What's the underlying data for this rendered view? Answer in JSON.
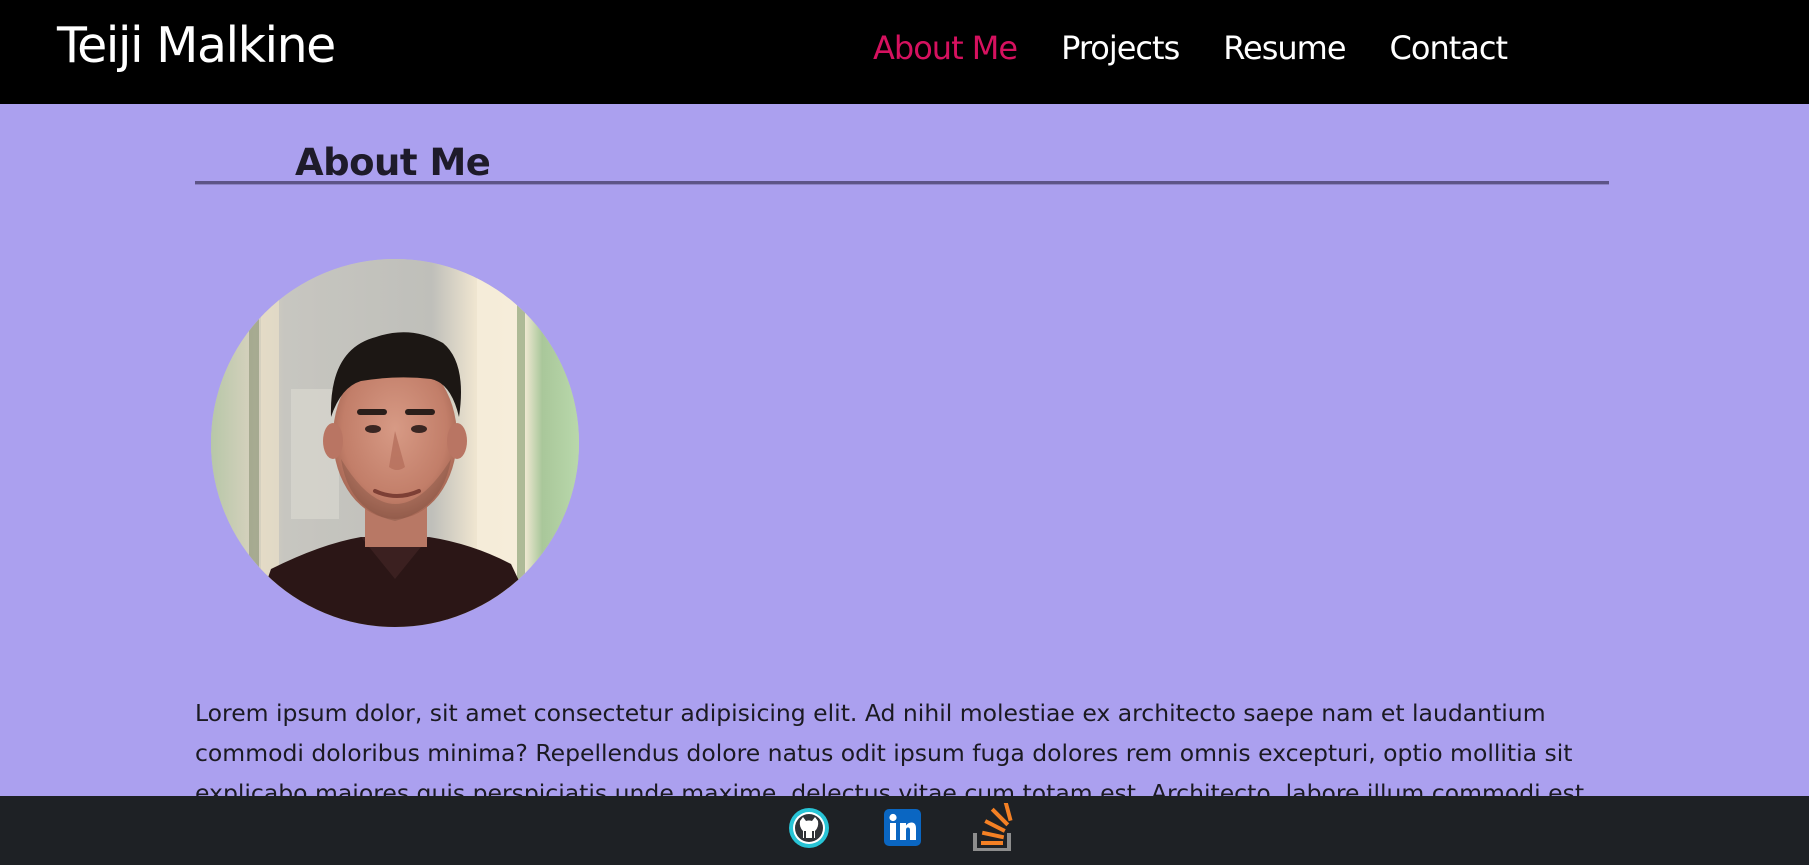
{
  "header": {
    "brand": "Teiji Malkine",
    "nav": [
      {
        "label": "About Me",
        "active": true
      },
      {
        "label": "Projects",
        "active": false
      },
      {
        "label": "Resume",
        "active": false
      },
      {
        "label": "Contact",
        "active": false
      }
    ]
  },
  "about": {
    "title": "About Me",
    "paragraph": "Lorem ipsum dolor, sit amet consectetur adipisicing elit. Ad nihil molestiae ex architecto saepe nam et laudantium commodi doloribus minima? Repellendus dolore natus odit ipsum fuga dolores rem omnis excepturi, optio mollitia sit explicabo maiores quis perspiciatis unde maxime, delectus vitae cum totam est. Architecto, labore illum commodi est"
  },
  "footer": {
    "social_icons": [
      "github-icon",
      "linkedin-icon",
      "stack-overflow-icon"
    ]
  },
  "colors": {
    "page_background": "#aba0ef",
    "header_background": "#000000",
    "footer_background": "#1e2125",
    "nav_active": "#d6115f",
    "nav_text": "#ffffff",
    "divider": "#5d5487"
  }
}
